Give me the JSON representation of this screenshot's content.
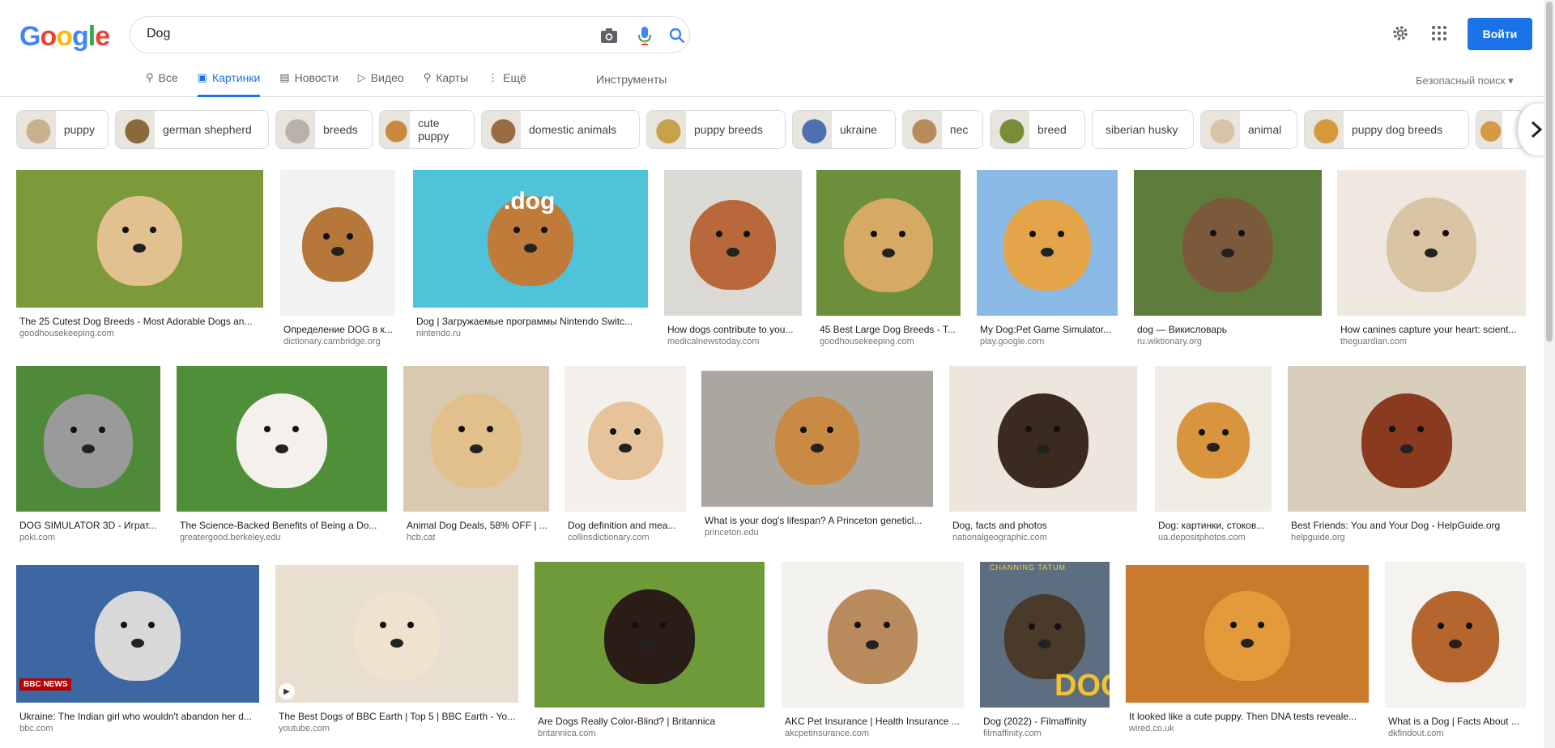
{
  "logo": {
    "l1": "G",
    "l2": "o",
    "l3": "o",
    "l4": "g",
    "l5": "l",
    "l6": "e"
  },
  "search": {
    "query": "Dog"
  },
  "header": {
    "signin_label": "Войти"
  },
  "tabs": [
    {
      "label": "Все",
      "icon": "search-icon",
      "glyph": "⚲"
    },
    {
      "label": "Картинки",
      "icon": "image-icon",
      "glyph": "▣"
    },
    {
      "label": "Новости",
      "icon": "newspaper-icon",
      "glyph": "▤"
    },
    {
      "label": "Видео",
      "icon": "play-icon",
      "glyph": "▷"
    },
    {
      "label": "Карты",
      "icon": "map-pin-icon",
      "glyph": "⚲"
    },
    {
      "label": "Ещё",
      "icon": "more-vert-icon",
      "glyph": "⋮"
    }
  ],
  "tools_label": "Инструменты",
  "safesearch_label": "Безопасный поиск ▾",
  "chips": [
    {
      "label": "puppy",
      "color": "#c9b08f"
    },
    {
      "label": "german shepherd",
      "color": "#8a6a3a"
    },
    {
      "label": "breeds",
      "color": "#b8b2aa"
    },
    {
      "label": "cute puppy",
      "color": "#c98a3d"
    },
    {
      "label": "domestic animals",
      "color": "#9a6a42"
    },
    {
      "label": "puppy breeds",
      "color": "#c8a24b"
    },
    {
      "label": "ukraine",
      "color": "#4c6fb0"
    },
    {
      "label": "пес",
      "color": "#b98a5a"
    },
    {
      "label": "breed",
      "color": "#7a8c3a"
    },
    {
      "label": "siberian husky",
      "color": ""
    },
    {
      "label": "animal",
      "color": "#d8c4a4"
    },
    {
      "label": "puppy dog breeds",
      "color": "#d69a3a"
    },
    {
      "label": "",
      "color": "#d49a46"
    }
  ],
  "results": [
    {
      "title": "The 25 Cutest Dog Breeds - Most Adorable Dogs an...",
      "domain": "goodhousekeeping.com",
      "bg": "#7c9a3a",
      "dog": "#e3c08f"
    },
    {
      "title": "Определение DOG в к...",
      "domain": "dictionary.cambridge.org",
      "bg": "#f2f2f2",
      "dog": "#b7773a"
    },
    {
      "title": "Dog | Загружаемые программы Nintendo Switc...",
      "domain": "nintendo.ru",
      "bg": "#4fc3d9",
      "dog": "#c07a3a"
    },
    {
      "title": "How dogs contribute to you...",
      "domain": "medicalnewstoday.com",
      "bg": "#dad9d3",
      "dog": "#b8683a"
    },
    {
      "title": "45 Best Large Dog Breeds - T...",
      "domain": "goodhousekeeping.com",
      "bg": "#6b8f3a",
      "dog": "#d6aa62"
    },
    {
      "title": "My Dog:Pet Game Simulator...",
      "domain": "play.google.com",
      "bg": "#8ab9e6",
      "dog": "#e4a54a"
    },
    {
      "title": "dog — Викисловарь",
      "domain": "ru.wiktionary.org",
      "bg": "#5f7d3a",
      "dog": "#7a5a3a"
    },
    {
      "title": "How canines capture your heart: scient...",
      "domain": "theguardian.com",
      "bg": "#eee8e0",
      "dog": "#d8c3a3"
    },
    {
      "title": "DOG SIMULATOR 3D - Играт...",
      "domain": "poki.com",
      "bg": "#4f8a3a",
      "dog": "#9a9a9a"
    },
    {
      "title": "The Science-Backed Benefits of Being a Do...",
      "domain": "greatergood.berkeley.edu",
      "bg": "#4f8f3a",
      "dog": "#f4f1ec"
    },
    {
      "title": "Animal Dog Deals, 58% OFF | ...",
      "domain": "hcb.cat",
      "bg": "#d9c9b0",
      "dog": "#e2c08c"
    },
    {
      "title": "Dog definition and mea...",
      "domain": "collinsdictionary.com",
      "bg": "#f3f0ec",
      "dog": "#e6c39a"
    },
    {
      "title": "What is your dog's lifespan? A Princeton geneticl...",
      "domain": "princeton.edu",
      "bg": "#a9a79f",
      "dog": "#c98a45"
    },
    {
      "title": "Dog, facts and photos",
      "domain": "nationalgeographic.com",
      "bg": "#ede6dd",
      "dog": "#3a2a1f"
    },
    {
      "title": "Dog: картинки, стоков...",
      "domain": "ua.depositphotos.com",
      "bg": "#f0ece6",
      "dog": "#d9953e"
    },
    {
      "title": "Best Friends: You and Your Dog - HelpGuide.org",
      "domain": "helpguide.org",
      "bg": "#d9cdbb",
      "dog": "#8a3a1f"
    },
    {
      "title": "Ukraine: The Indian girl who wouldn't abandon her d...",
      "domain": "bbc.com",
      "bg": "#3c67a3",
      "dog": "#d8d8d8"
    },
    {
      "title": "The Best Dogs of BBC Earth | Top 5 | BBC Earth - Yo...",
      "domain": "youtube.com",
      "bg": "#e9dfd0",
      "dog": "#efe3cf"
    },
    {
      "title": "Are Dogs Really Color-Blind? | Britannica",
      "domain": "britannica.com",
      "bg": "#6e9a3a",
      "dog": "#2a1d17"
    },
    {
      "title": "AKC Pet Insurance | Health Insurance ...",
      "domain": "akcpetinsurance.com",
      "bg": "#f4f2ef",
      "dog": "#b98a5c"
    },
    {
      "title": "Dog (2022) - Filmaffinity",
      "domain": "filmaffinity.com",
      "bg": "#5d6e80",
      "dog": "#4a3a2a"
    },
    {
      "title": "It looked like a cute puppy. Then DNA tests reveale...",
      "domain": "wired.co.uk",
      "bg": "#c97a2a",
      "dog": "#e39a3a"
    },
    {
      "title": "What is a Dog | Facts About ...",
      "domain": "dkfindout.com",
      "bg": "#f5f3f0",
      "dog": "#b5652e"
    }
  ],
  "overlays": {
    "bbc_news": "BBC NEWS",
    "dog_word": ".dog",
    "poster_word": "DOG",
    "poster_top": "CHANNING TATUM"
  }
}
